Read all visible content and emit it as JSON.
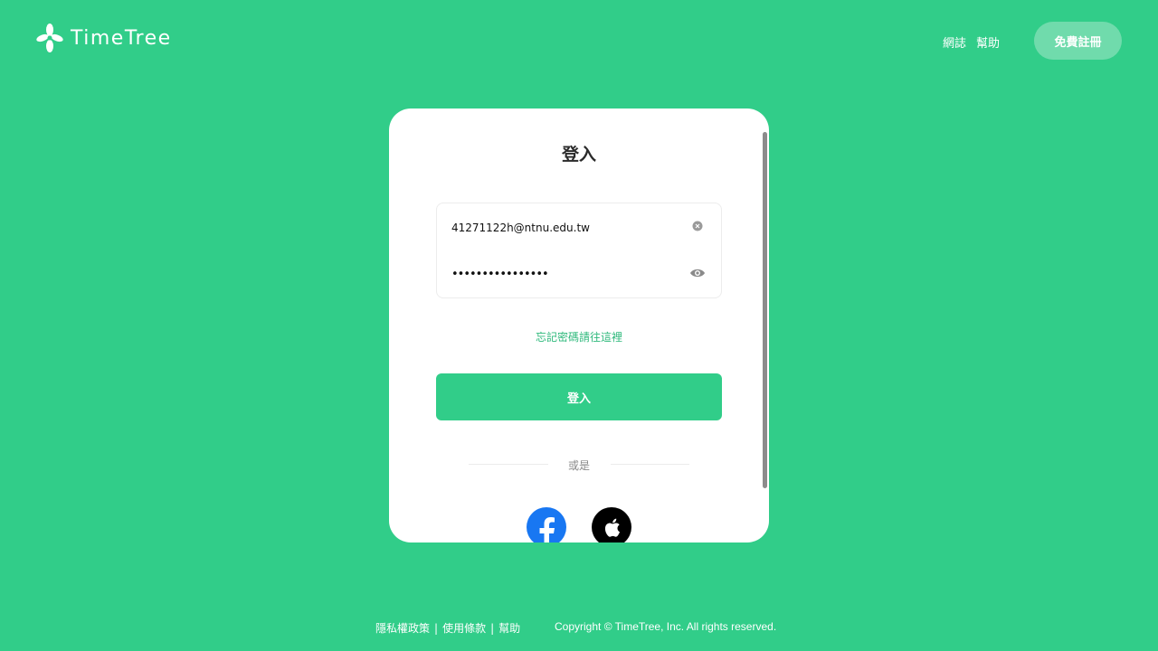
{
  "header": {
    "logo_text": "TimeTree",
    "nav": {
      "blog": "網誌",
      "help": "幫助"
    },
    "signup_label": "免費註冊"
  },
  "login_card": {
    "title": "登入",
    "email_value": "41271122h@ntnu.edu.tw",
    "password_mask": "••••••••••••••••",
    "forgot_link": "忘記密碼請往這裡",
    "login_button": "登入",
    "divider_text": "或是",
    "social": [
      "facebook-icon",
      "apple-icon"
    ]
  },
  "footer": {
    "links": [
      "隱私權政策",
      "使用條款",
      "幫助"
    ],
    "separator": "|",
    "copyright": "Copyright © TimeTree, Inc. All rights reserved."
  },
  "colors": {
    "background": "#31cd89",
    "accent_text": "#2fb97c",
    "signup_button": "#70dbac",
    "facebook": "#1877f2"
  }
}
